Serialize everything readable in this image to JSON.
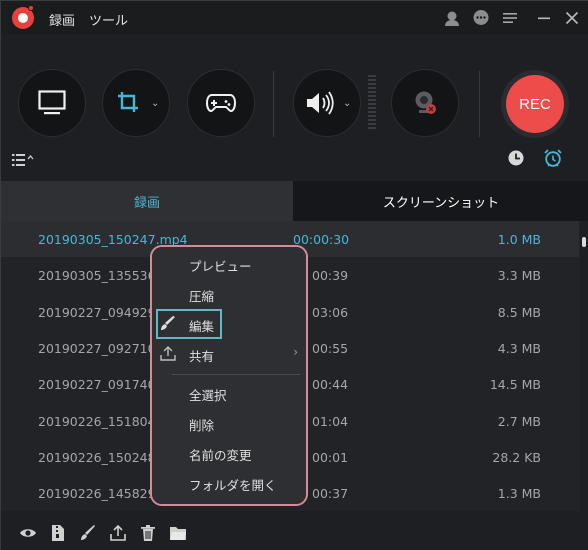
{
  "titlebar": {
    "menu": [
      "録画",
      "ツール"
    ],
    "icons": [
      "user-icon",
      "chat-icon",
      "menu-icon",
      "minimize-icon",
      "close-icon"
    ]
  },
  "toolbar": {
    "buttons": [
      "monitor-icon",
      "crop-icon",
      "gamepad-icon",
      "speaker-icon",
      "webcam-icon"
    ],
    "rec_label": "REC",
    "colors": {
      "rec": "#ee4b4b",
      "accent": "#45b8d8"
    }
  },
  "tabs": [
    {
      "label": "録画",
      "active": true
    },
    {
      "label": "スクリーンショット",
      "active": false
    }
  ],
  "files": [
    {
      "name": "20190305_150247.mp4",
      "duration": "00:00:30",
      "size": "1.0 MB",
      "selected": true
    },
    {
      "name": "20190305_135536",
      "duration": "00:39",
      "size": "3.3 MB"
    },
    {
      "name": "20190227_094929",
      "duration": "03:06",
      "size": "8.5 MB"
    },
    {
      "name": "20190227_092710",
      "duration": "00:55",
      "size": "4.3 MB"
    },
    {
      "name": "20190227_091740",
      "duration": "00:44",
      "size": "14.5 MB"
    },
    {
      "name": "20190226_151804",
      "duration": "01:04",
      "size": "2.7 MB"
    },
    {
      "name": "20190226_150248",
      "duration": "00:01",
      "size": "28.2 KB"
    },
    {
      "name": "20190226_145829",
      "duration": "00:37",
      "size": "1.3 MB"
    }
  ],
  "context_menu": {
    "items": [
      "プレビュー",
      "圧縮",
      "編集",
      "共有",
      "全選択",
      "削除",
      "名前の変更",
      "フォルダを開く"
    ],
    "highlighted": "編集"
  },
  "bottombar": {
    "icons": [
      "eye-icon",
      "compress-icon",
      "edit-icon",
      "share-icon",
      "trash-icon",
      "folder-icon"
    ]
  }
}
